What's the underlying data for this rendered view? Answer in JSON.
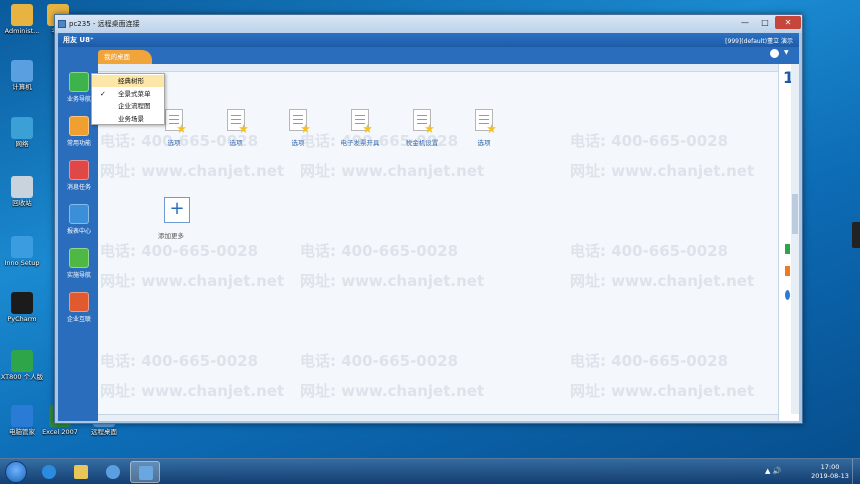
{
  "desktop": {
    "icons": [
      {
        "label": "Administ...",
        "color": "#e8b341"
      },
      {
        "label": "计算机",
        "color": "#5aa0e0"
      },
      {
        "label": "网络",
        "color": "#3aa0d6"
      },
      {
        "label": "回收站",
        "color": "#c9d3de"
      },
      {
        "label": "Inno Setup",
        "color": "#3b9ce0"
      },
      {
        "label": "PyCharm",
        "color": "#1b1b1b"
      },
      {
        "label": "XT800 个人版",
        "color": "#2fa54a"
      },
      {
        "label": "电脑管家",
        "color": "#2a7bd6"
      }
    ],
    "col2": [
      {
        "label": "考勤",
        "color": "#e8b341"
      },
      {
        "label": "Excel 2007",
        "color": "#2f8a3f"
      },
      {
        "label": "远程桌面",
        "color": "#5aa0e0"
      }
    ]
  },
  "window": {
    "title": "pc235 - 远程桌面连接",
    "min": "—",
    "max": "□",
    "close": "✕"
  },
  "app": {
    "logo": "用友 U8⁺",
    "userinfo": "[999](default)董立 演示",
    "tab": "我的桌面",
    "caret": "▼",
    "nav": [
      {
        "label": "业务导航",
        "color": "#3cb44b"
      },
      {
        "label": "常用功能",
        "color": "#f0a030"
      },
      {
        "label": "消息任务",
        "color": "#e04848"
      },
      {
        "label": "报表中心",
        "color": "#3a8fd8"
      },
      {
        "label": "实施导航",
        "color": "#4fb845"
      },
      {
        "label": "企业互联",
        "color": "#e05a30"
      }
    ],
    "tiles": [
      {
        "label": "选项"
      },
      {
        "label": "选项"
      },
      {
        "label": "选项"
      },
      {
        "label": "电子发票开具"
      },
      {
        "label": "税金机设置"
      },
      {
        "label": "选项"
      }
    ],
    "add_symbol": "+",
    "add_label": "添加更多",
    "right_number": "1"
  },
  "menu": {
    "items": [
      {
        "label": "经典树形",
        "checked": false,
        "highlighted": true
      },
      {
        "label": "全景式菜单",
        "checked": true,
        "highlighted": false
      },
      {
        "label": "企业流程图",
        "checked": false,
        "highlighted": false
      },
      {
        "label": "业务场景",
        "checked": false,
        "highlighted": false
      }
    ],
    "check_glyph": "✓"
  },
  "watermark": {
    "phone": "电话: 400-665-0028",
    "site": "网址: www.chanjet.net"
  },
  "taskbar": {
    "time": "17:00",
    "date": "2019-08-13",
    "tray": "▲ 🔊"
  }
}
